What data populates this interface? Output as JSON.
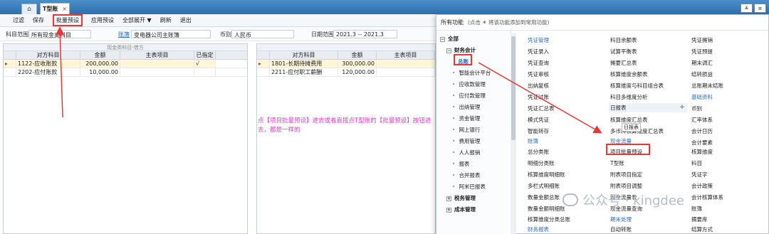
{
  "tabs": {
    "home_icon": "home-icon",
    "current_tab": "T型账",
    "close": "×"
  },
  "window_buttons": [
    "≚",
    "≡"
  ],
  "toolbar": {
    "items": [
      "过滤",
      "保存",
      "批量预设",
      "应用预设",
      "全部展开 ▼",
      "刷新",
      "退出"
    ]
  },
  "filter": {
    "subject_range_label": "科目范围",
    "subject_range_value": "所有现金类科目",
    "book_label": "账簿",
    "book_value": "变电器公司主账簿",
    "currency_label": "币别",
    "currency_value": "人民币",
    "date_label": "日期范围",
    "date_value": "2021.3 -- 2021.3"
  },
  "left_grid": {
    "caption": "现金类科目-借方",
    "headers": [
      "对方科目",
      "金额",
      "主表项目",
      "已指定"
    ],
    "rows": [
      {
        "account": "1122-应收账款",
        "amount": "200,000.00",
        "item": "",
        "assigned": "√"
      },
      {
        "account": "2202-应付账款",
        "amount": "10,000.00",
        "item": "",
        "assigned": ""
      }
    ]
  },
  "right_grid": {
    "headers": [
      "对方科目",
      "金额",
      "主表项目"
    ],
    "rows": [
      {
        "account": "1801-长期待摊费用",
        "amount": "300,000.00",
        "item": ""
      },
      {
        "account": "2211-应付职工薪酬",
        "amount": "120,000.00",
        "item": ""
      }
    ]
  },
  "annotation": "点【项目批量预设】进去或者直接点T型账的【批量预设】按钮进去，都是一样的",
  "panel": {
    "header": "所有功能",
    "hint": "(点击 ✶ 将该功能添加到常用功能)",
    "tree": {
      "root": "全部",
      "finance": "财务会计",
      "gl": "总账",
      "items": [
        "智能会计平台",
        "应收款管理",
        "应付款管理",
        "出纳管理",
        "资金管理",
        "网上银行",
        "费用管理",
        "人人报销",
        "报表",
        "合并报表",
        "阿米巴报表"
      ],
      "groups": [
        "税务管理",
        "成本管理"
      ]
    },
    "col1": {
      "head1": "凭证管理",
      "items1": [
        "凭证录入",
        "凭证查询",
        "凭证审核",
        "出纳复核",
        "凭证过账",
        "凭证汇总表",
        "模式凭证",
        "智能转存"
      ],
      "head2": "账簿",
      "items2": [
        "总分类账",
        "明细分类账",
        "核算维度明细账",
        "多栏式明细账",
        "数量金额总账",
        "数量金额明细账",
        "核算维度分类总账"
      ],
      "head3": "财务报表"
    },
    "col2": {
      "items1": [
        "科目余额表",
        "试算平衡表",
        "摊要汇总表",
        "核算维度余额表",
        "核算维度与科目组合表",
        "科目多维度分析"
      ],
      "day_report": "日报表",
      "items1b": [
        "核算维度汇总表",
        "多币种核算维度汇总表"
      ],
      "tooltip": "日报表",
      "head2": "现金流量",
      "items2": [
        "项目批量预设",
        "T型账",
        "附表项目指定",
        "附表项目调整",
        "现金流量表",
        "现金流量查询"
      ],
      "head3": "期末处理",
      "tail": "自动转账"
    },
    "col3": {
      "items1": [
        "凭证摊销",
        "凭证预提",
        "期末调汇",
        "结转损益",
        "总账期末结账"
      ],
      "head2": "基础资料",
      "items2": [
        "币别",
        "汇率体系",
        "会计日历",
        "会计要素",
        "核算维度",
        "科目",
        "凭证字",
        "会计政策",
        "会计核算体系",
        "账簿",
        "摘要库",
        "结算方式"
      ]
    }
  },
  "watermark": "公众号 · kingdee"
}
